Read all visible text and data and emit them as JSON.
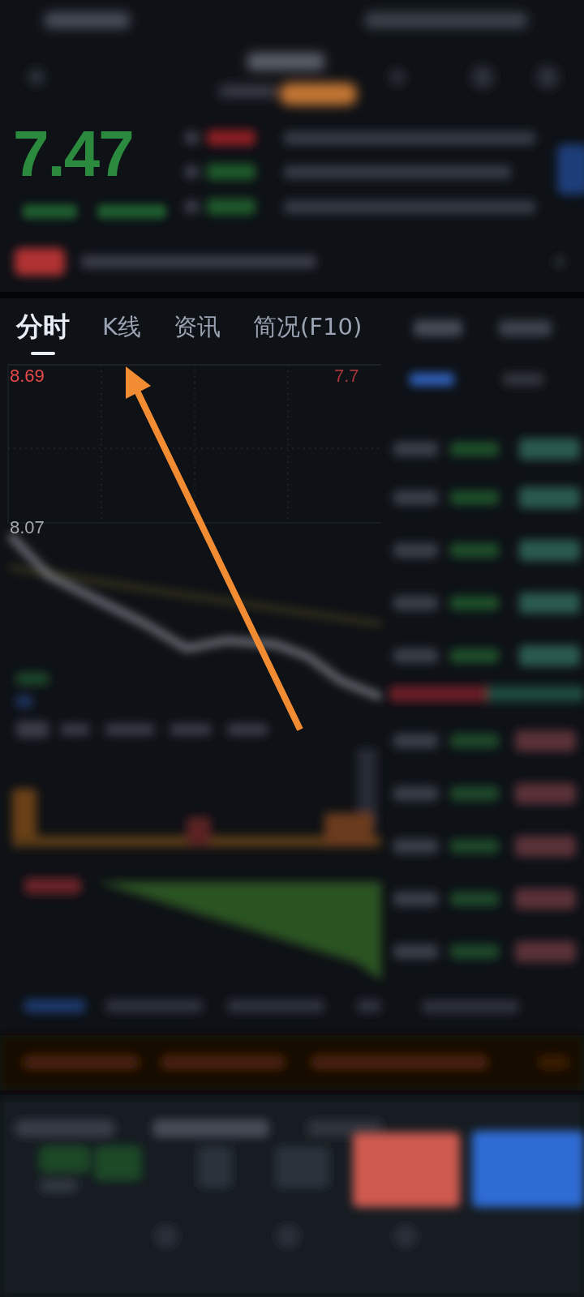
{
  "quote": {
    "price": "7.47"
  },
  "chart_tabs": [
    {
      "label": "分时",
      "selected": true
    },
    {
      "label": "K线",
      "selected": false
    },
    {
      "label": "资讯",
      "selected": false
    },
    {
      "label": "简况(F10)",
      "selected": false
    }
  ],
  "chart": {
    "top_price": "8.69",
    "top_change": "7.7",
    "mid_price": "8.07"
  }
}
